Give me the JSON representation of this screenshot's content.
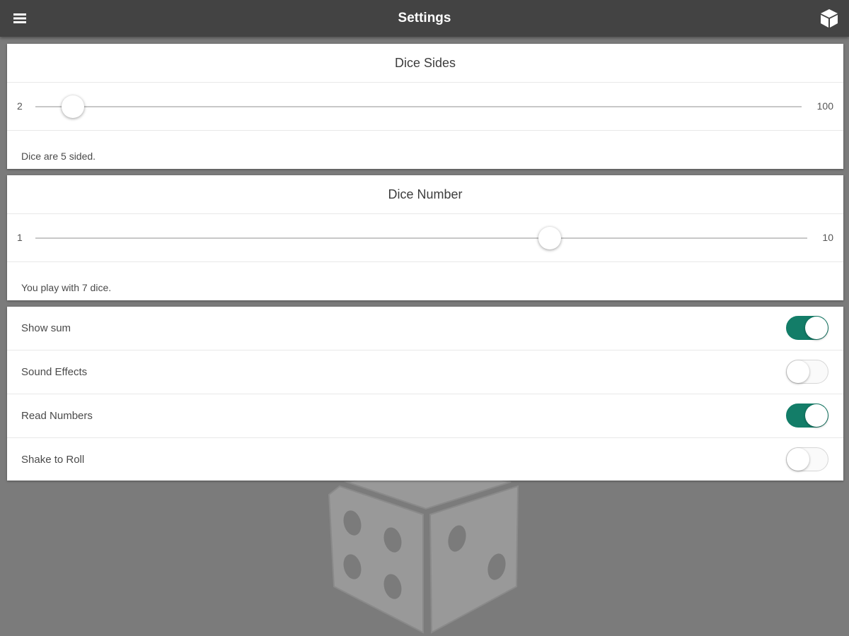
{
  "header": {
    "title": "Settings",
    "menu_icon": "hamburger-menu-icon",
    "roll_icon": "dice-cube-icon"
  },
  "dice_sides": {
    "title": "Dice Sides",
    "min_label": "2",
    "max_label": "100",
    "min": 2,
    "max": 100,
    "value": 5,
    "caption": "Dice are 5 sided."
  },
  "dice_number": {
    "title": "Dice Number",
    "min_label": "1",
    "max_label": "10",
    "min": 1,
    "max": 10,
    "value": 7,
    "caption": "You play with 7 dice."
  },
  "toggles": [
    {
      "label": "Show sum",
      "on": true
    },
    {
      "label": "Sound Effects",
      "on": false
    },
    {
      "label": "Read Numbers",
      "on": true
    },
    {
      "label": "Shake to Roll",
      "on": false
    }
  ],
  "colors": {
    "toolbar": "#434343",
    "background": "#7b7b7b",
    "accent": "#137d68",
    "card": "#ffffff"
  }
}
